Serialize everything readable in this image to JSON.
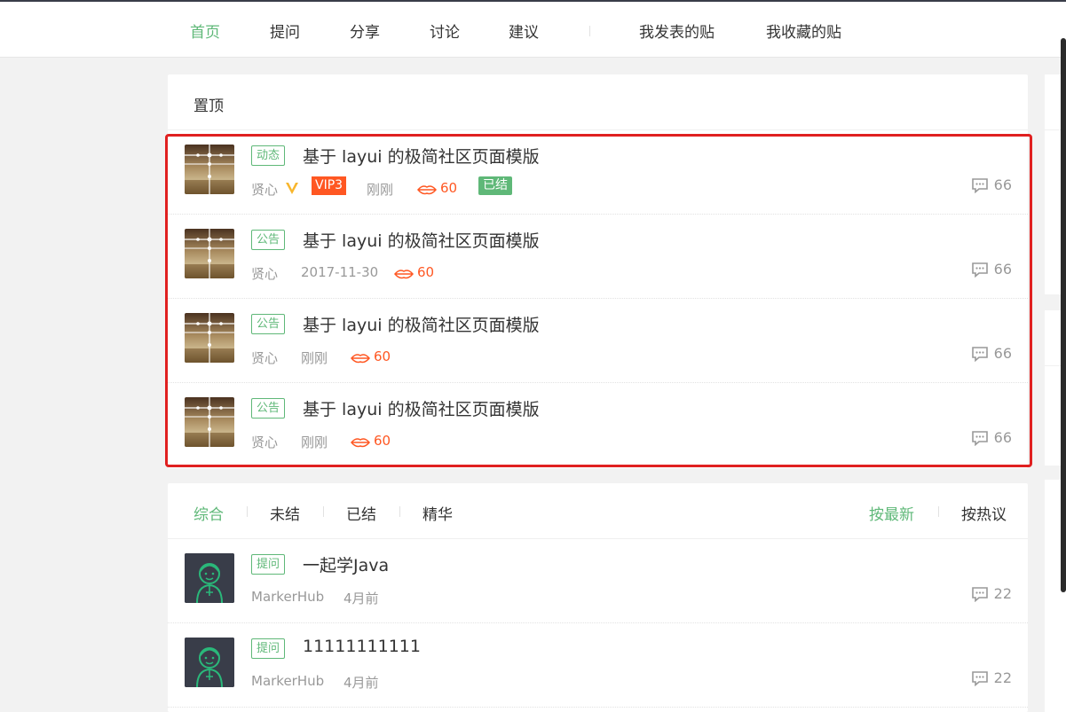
{
  "nav": {
    "items": [
      "首页",
      "提问",
      "分享",
      "讨论",
      "建议",
      "我发表的贴",
      "我收藏的贴"
    ],
    "active": "首页"
  },
  "top": {
    "title": "置顶",
    "posts": [
      {
        "tag": "动态",
        "title": "基于 layui 的极简社区页面模版",
        "author": "贤心",
        "verified": true,
        "vip": "VIP3",
        "time": "刚刚",
        "kiss": "60",
        "solved": "已结",
        "comments": "66"
      },
      {
        "tag": "公告",
        "title": "基于 layui 的极简社区页面模版",
        "author": "贤心",
        "time": "2017-11-30",
        "kiss": "60",
        "comments": "66"
      },
      {
        "tag": "公告",
        "title": "基于 layui 的极简社区页面模版",
        "author": "贤心",
        "time": "刚刚",
        "kiss": "60",
        "comments": "66"
      },
      {
        "tag": "公告",
        "title": "基于 layui 的极简社区页面模版",
        "author": "贤心",
        "time": "刚刚",
        "kiss": "60",
        "comments": "66"
      }
    ]
  },
  "list": {
    "tabs": [
      "综合",
      "未结",
      "已结",
      "精华"
    ],
    "active_tab": "综合",
    "sort": [
      "按最新",
      "按热议"
    ],
    "active_sort": "按最新",
    "posts": [
      {
        "tag": "提问",
        "title": "一起学Java",
        "author": "MarkerHub",
        "time": "4月前",
        "comments": "22"
      },
      {
        "tag": "提问",
        "title": "11111111111",
        "author": "MarkerHub",
        "time": "4月前",
        "comments": "22"
      }
    ]
  },
  "colors": {
    "accent": "#5fb878",
    "vip": "#ff5722",
    "highlight": "#e02020"
  }
}
